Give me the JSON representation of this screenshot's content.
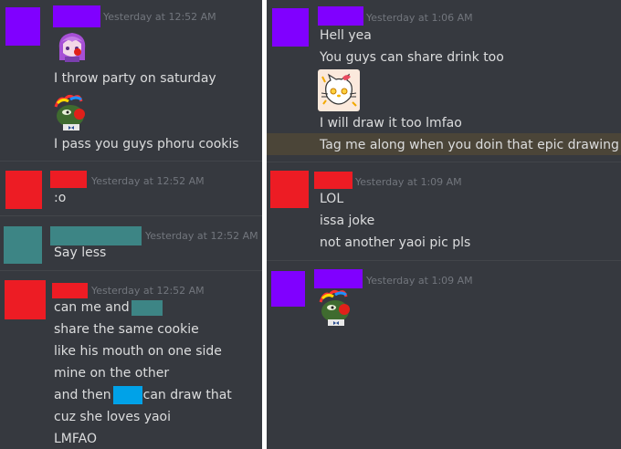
{
  "colors": {
    "background": "#36393f",
    "text": "#dcddde",
    "timestamp": "#72767d",
    "purple": "#8000ff",
    "red": "#ed1c24",
    "teal": "#3d8585",
    "blue": "#00a2e8",
    "highlight": "#4b4538"
  },
  "left": {
    "groups": [
      {
        "timestamp": "Yesterday at 12:52 AM",
        "lines": [
          "I throw party on saturday",
          "I pass you guys phoru cookis"
        ],
        "emojis": [
          "anime-girl-clown-nose-emoji",
          "frog-clown-nose-emoji"
        ]
      },
      {
        "timestamp": "Yesterday at 12:52 AM",
        "lines": [
          ":o"
        ]
      },
      {
        "timestamp": "Yesterday at 12:52 AM",
        "lines": [
          "Say less"
        ]
      },
      {
        "timestamp": "Yesterday at 12:52 AM",
        "lines": [
          "can me and",
          "share the same cookie",
          "like his mouth on one side",
          "mine on the other",
          "and then",
          "can draw that",
          "cuz she loves yaoi",
          "LMFAO"
        ]
      }
    ]
  },
  "right": {
    "groups": [
      {
        "timestamp": "Yesterday at 1:06 AM",
        "lines": [
          "Hell yea",
          "You guys can share drink too",
          "I will draw it too lmfao",
          "Tag me along when you doin that epic drawing"
        ],
        "emojis": [
          "hello-kitty-emoji"
        ]
      },
      {
        "timestamp": "Yesterday at 1:09 AM",
        "lines": [
          "LOL",
          "issa joke",
          "not another yaoi pic pls"
        ]
      },
      {
        "timestamp": "Yesterday at 1:09 AM",
        "emojis": [
          "frog-clown-nose-emoji"
        ]
      }
    ]
  }
}
